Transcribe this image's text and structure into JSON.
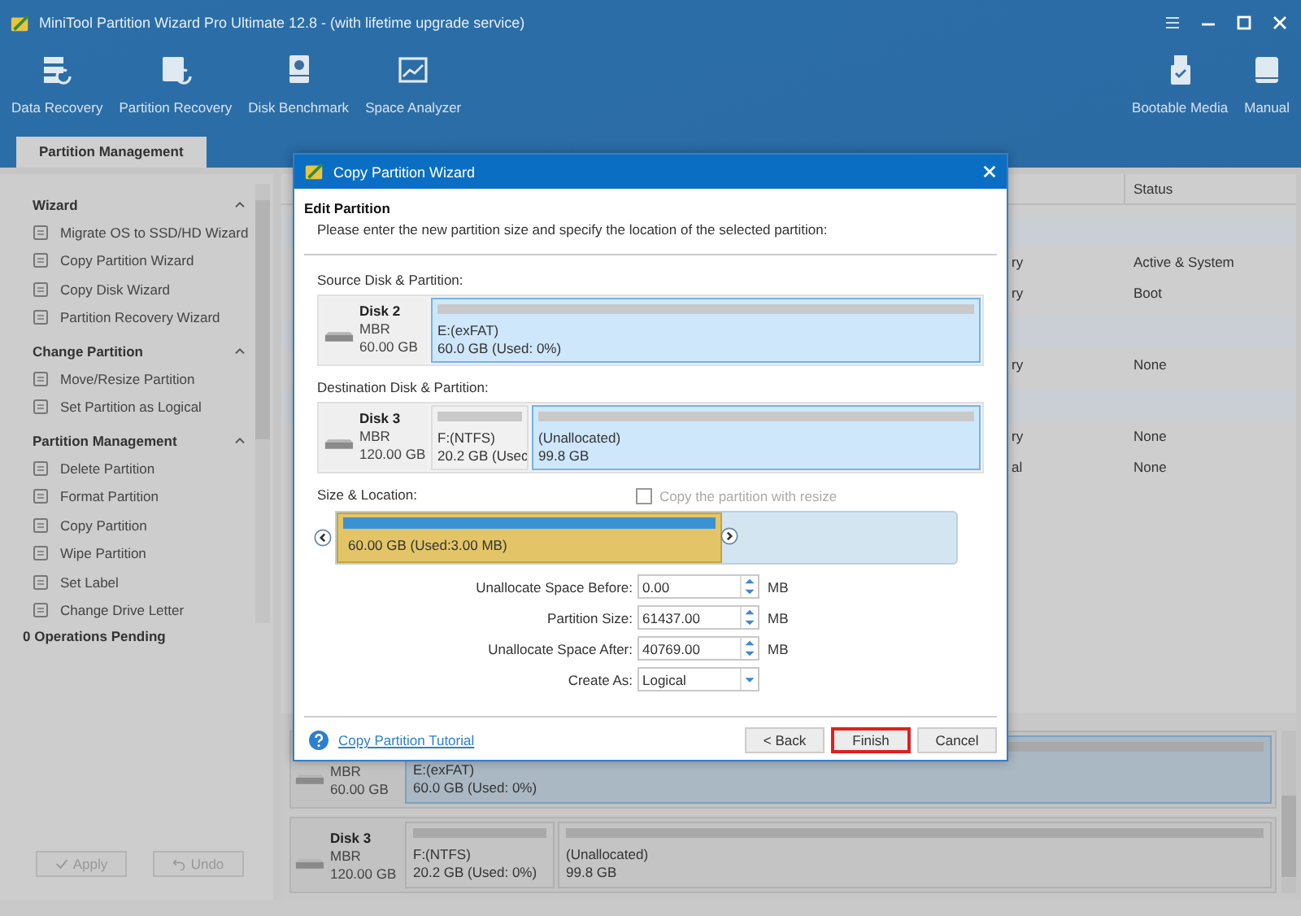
{
  "window": {
    "title": "MiniTool Partition Wizard Pro Ultimate 12.8 - (with lifetime upgrade service)"
  },
  "toolbar": [
    {
      "label": "Data Recovery"
    },
    {
      "label": "Partition Recovery"
    },
    {
      "label": "Disk Benchmark"
    },
    {
      "label": "Space Analyzer"
    }
  ],
  "toolbar_right": [
    {
      "label": "Bootable Media"
    },
    {
      "label": "Manual"
    }
  ],
  "tabs": [
    {
      "label": "Partition Management",
      "selected": true
    }
  ],
  "sidebar": {
    "groups": [
      {
        "title": "Wizard",
        "expanded": true,
        "items": [
          "Migrate OS to SSD/HD Wizard",
          "Copy Partition Wizard",
          "Copy Disk Wizard",
          "Partition Recovery Wizard"
        ]
      },
      {
        "title": "Change Partition",
        "expanded": true,
        "items": [
          "Move/Resize Partition",
          "Set Partition as Logical"
        ]
      },
      {
        "title": "Partition Management",
        "expanded": true,
        "items": [
          "Delete Partition",
          "Format Partition",
          "Copy Partition",
          "Wipe Partition",
          "Set Label",
          "Change Drive Letter"
        ]
      }
    ],
    "pending": "0 Operations Pending",
    "buttons": [
      {
        "label": "Apply",
        "disabled": true
      },
      {
        "label": "Undo",
        "disabled": true
      }
    ]
  },
  "table": {
    "columns": [
      "Status"
    ],
    "rows": [
      {
        "column_1": "ry",
        "status": "Active & System",
        "first_in_disk": true
      },
      {
        "column_1": "ry",
        "status": "Boot",
        "first_in_disk": false
      },
      {
        "column_1": "ry",
        "status": "None",
        "first_in_disk": true
      },
      {
        "column_1": "ry",
        "status": "None",
        "first_in_disk": true
      },
      {
        "column_1": "al",
        "status": "None",
        "first_in_disk": false
      }
    ]
  },
  "disk_map": [
    {
      "type": "MBR",
      "size": "60.00 GB",
      "partitions": [
        {
          "name": "E:(exFAT)",
          "info": "60.0 GB (Used: 0%)",
          "selected": true
        }
      ]
    },
    {
      "name": "Disk 3",
      "type": "MBR",
      "size": "120.00 GB",
      "partitions": [
        {
          "name": "F:(NTFS)",
          "info": "20.2 GB (Used: 0%)",
          "selected": false
        },
        {
          "name": "(Unallocated)",
          "info": "99.8 GB",
          "selected": false
        }
      ]
    }
  ],
  "dialog": {
    "title": "Copy Partition Wizard",
    "heading": "Edit Partition",
    "subtitle": "Please enter the new partition size and specify the location of the selected partition:",
    "source_label": "Source Disk & Partition:",
    "source": {
      "name": "Disk 2",
      "type": "MBR",
      "size": "60.00 GB",
      "partitions": [
        {
          "name": "E:(exFAT)",
          "info": "60.0 GB (Used: 0%)",
          "selected": true
        }
      ]
    },
    "destination_label": "Destination Disk & Partition:",
    "destination": {
      "name": "Disk 3",
      "type": "MBR",
      "size": "120.00 GB",
      "partitions": [
        {
          "name": "F:(NTFS)",
          "info": "20.2 GB (Usec",
          "selected": false
        },
        {
          "name": "(Unallocated)",
          "info": "99.8 GB",
          "selected": true
        }
      ]
    },
    "size_label": "Size & Location:",
    "resize": {
      "label": "Copy the partition with resize",
      "checked": false,
      "disabled": true
    },
    "slider": {
      "label": "60.00 GB (Used:3.00 MB)"
    },
    "fields": [
      {
        "label": "Unallocate Space Before:",
        "value": "0.00",
        "unit": "MB"
      },
      {
        "label": "Partition Size:",
        "value": "61437.00",
        "unit": "MB"
      },
      {
        "label": "Unallocate Space After:",
        "value": "40769.00",
        "unit": "MB"
      }
    ],
    "create_as": {
      "label": "Create As:",
      "value": "Logical"
    },
    "tutorial": "Copy Partition Tutorial",
    "buttons": [
      {
        "label": "< Back",
        "highlighted": false
      },
      {
        "label": "Finish",
        "highlighted": true
      },
      {
        "label": "Cancel",
        "highlighted": false
      }
    ]
  }
}
